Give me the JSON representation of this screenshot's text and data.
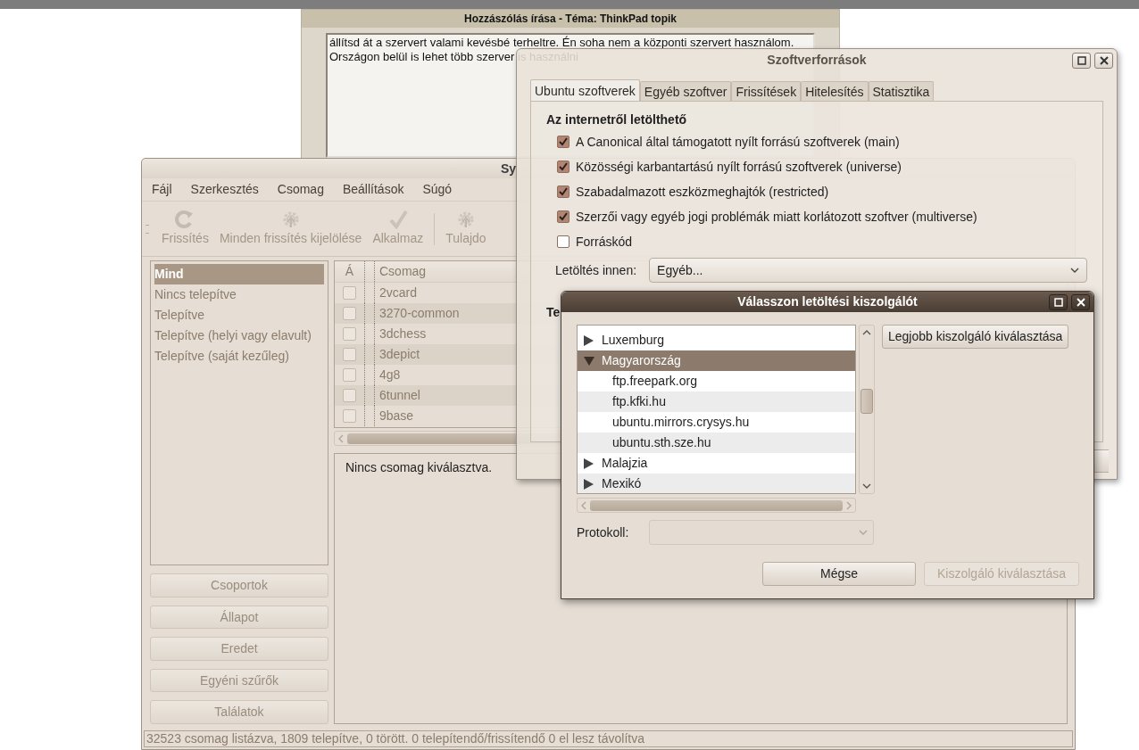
{
  "forum_window": {
    "title": "Hozzászólás írása - Téma: ThinkPad topik",
    "message_lines": [
      "állítsd át a szervert valami kevésbé terheltre. Én soha nem a központi szervert használom.",
      "Országon belül is lehet több szerver is használni"
    ]
  },
  "synaptic_window": {
    "title": "Sy",
    "menu": [
      "Fájl",
      "Szerkesztés",
      "Csomag",
      "Beállítások",
      "Súgó"
    ],
    "toolbar": [
      {
        "kind": "refresh",
        "label": "Frissítés",
        "disabled": true
      },
      {
        "kind": "gear",
        "label": "Minden frissítés kijelölése",
        "disabled": true
      },
      {
        "kind": "check",
        "label": "Alkalmaz",
        "disabled": true
      },
      {
        "kind": "separator"
      },
      {
        "kind": "gear",
        "label": "Tulajdo",
        "disabled": true
      }
    ],
    "filters": [
      {
        "label": "Mind",
        "selected": true
      },
      {
        "label": "Nincs telepítve",
        "selected": false
      },
      {
        "label": "Telepítve",
        "selected": false
      },
      {
        "label": "Telepítve (helyi vagy elavult)",
        "selected": false
      },
      {
        "label": "Telepítve (saját kezűleg)",
        "selected": false
      }
    ],
    "filter_buttons": [
      "Csoportok",
      "Állapot",
      "Eredet",
      "Egyéni szűrők",
      "Találatok"
    ],
    "package_table": {
      "columns": [
        "Á",
        "Csomag"
      ],
      "rows": [
        {
          "name": "2vcard",
          "checked": false
        },
        {
          "name": "3270-common",
          "checked": false
        },
        {
          "name": "3dchess",
          "checked": false
        },
        {
          "name": "3depict",
          "checked": false
        },
        {
          "name": "4g8",
          "checked": false
        },
        {
          "name": "6tunnel",
          "checked": false
        },
        {
          "name": "9base",
          "checked": false
        }
      ]
    },
    "description": "Nincs csomag kiválasztva.",
    "status_bar": "32523 csomag listázva, 1809 telepítve, 0 törött. 0 telepítendő/frissítendő 0 el lesz távolítva"
  },
  "sources_window": {
    "title": "Szoftverforrások",
    "tabs": [
      {
        "label": "Ubuntu szoftverek",
        "selected": true
      },
      {
        "label": "Egyéb szoftver",
        "selected": false
      },
      {
        "label": "Frissítések",
        "selected": false
      },
      {
        "label": "Hitelesítés",
        "selected": false
      },
      {
        "label": "Statisztika",
        "selected": false
      }
    ],
    "section_title": "Az internetről letölthető",
    "options": [
      {
        "label": "A Canonical által támogatott nyílt forrású szoftverek (main)",
        "checked": true
      },
      {
        "label": "Közösségi karbantartású nyílt forrású szoftverek (universe)",
        "checked": true
      },
      {
        "label": "Szabadalmazott eszközmeghajtók (restricted)",
        "checked": true
      },
      {
        "label": "Szerzői vagy egyéb jogi problémák miatt korlátozott szoftver (multiverse)",
        "checked": true
      },
      {
        "label": "Forráskód",
        "checked": false
      }
    ],
    "download_label": "Letöltés innen:",
    "download_value": "Egyéb...",
    "section_2_title": "Te"
  },
  "server_dialog": {
    "title": "Válasszon letöltési kiszolgálót",
    "tree": [
      {
        "label": "Luxemburg",
        "expanded": false,
        "selected": false
      },
      {
        "label": "Magyarország",
        "expanded": true,
        "selected": true,
        "children": [
          {
            "label": "ftp.freepark.org",
            "selected": false
          },
          {
            "label": "ftp.kfki.hu",
            "selected": false
          },
          {
            "label": "ubuntu.mirrors.crysys.hu",
            "selected": false
          },
          {
            "label": "ubuntu.sth.sze.hu",
            "selected": false
          }
        ]
      },
      {
        "label": "Malajzia",
        "expanded": false,
        "selected": false
      },
      {
        "label": "Mexikó",
        "expanded": false,
        "selected": false
      }
    ],
    "best_button": "Legjobb kiszolgáló kiválasztása",
    "protocol_label": "Protokoll:",
    "protocol_disabled": true,
    "buttons": [
      {
        "label": "Mégse",
        "disabled": false
      },
      {
        "label": "Kiszolgáló kiválasztása",
        "disabled": true
      }
    ]
  }
}
